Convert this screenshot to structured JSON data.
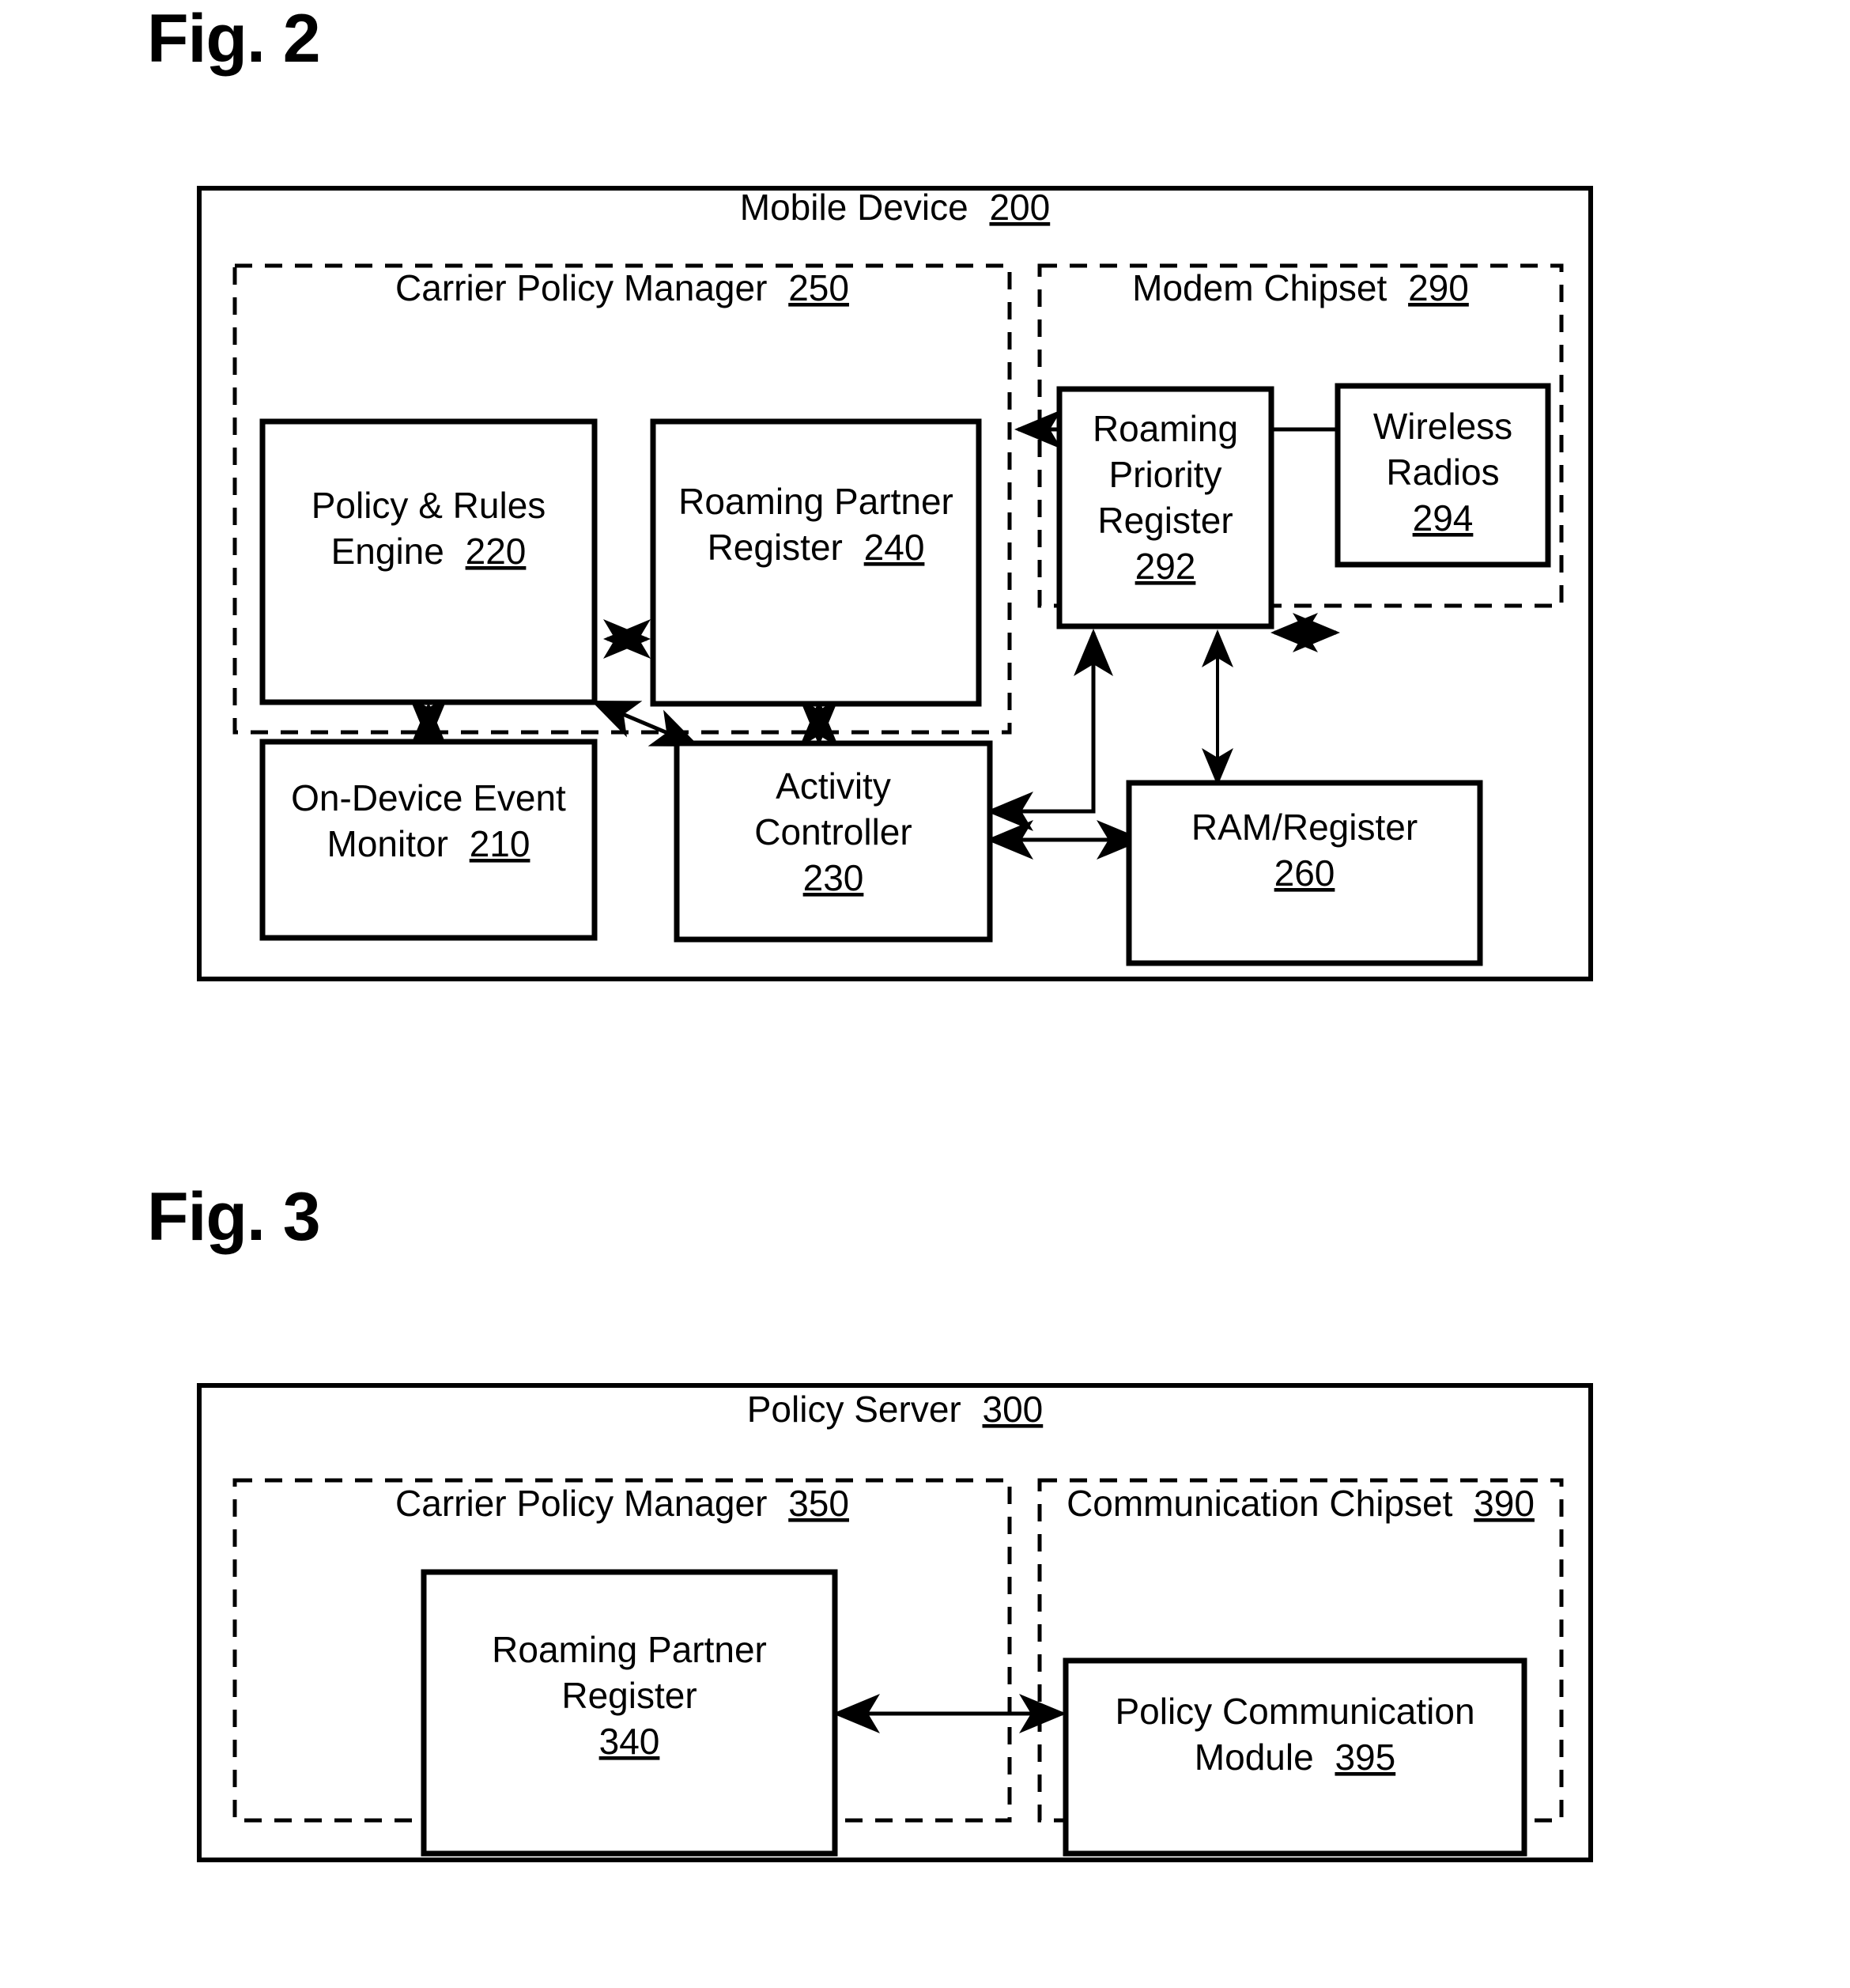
{
  "figures": [
    {
      "id": "fig2",
      "label": "Fig. 2",
      "outer": {
        "title_text": "Mobile Device",
        "title_ref": "200"
      },
      "sections": [
        {
          "name": "carrier-policy-manager",
          "title_text": "Carrier Policy Manager",
          "title_ref": "250"
        },
        {
          "name": "modem-chipset",
          "title_text": "Modem Chipset",
          "title_ref": "290"
        }
      ],
      "blocks": [
        {
          "name": "policy-rules-engine",
          "lines": [
            "Policy & Rules",
            "Engine"
          ],
          "ref": "220",
          "ref_on_line": 1
        },
        {
          "name": "roaming-partner-register",
          "lines": [
            "Roaming Partner",
            "Register"
          ],
          "ref": "240",
          "ref_on_line": 1
        },
        {
          "name": "on-device-event-monitor",
          "lines": [
            "On-Device Event",
            "Monitor"
          ],
          "ref": "210",
          "ref_on_line": 1
        },
        {
          "name": "activity-controller",
          "lines": [
            "Activity",
            "Controller"
          ],
          "ref": "230",
          "ref_on_line": 2
        },
        {
          "name": "roaming-priority-register",
          "lines": [
            "Roaming",
            "Priority",
            "Register"
          ],
          "ref": "292",
          "ref_on_line": 3
        },
        {
          "name": "wireless-radios",
          "lines": [
            "Wireless",
            "Radios"
          ],
          "ref": "294",
          "ref_on_line": 2
        },
        {
          "name": "ram-register",
          "lines": [
            "RAM/Register"
          ],
          "ref": "260",
          "ref_on_line": 1
        }
      ]
    },
    {
      "id": "fig3",
      "label": "Fig. 3",
      "outer": {
        "title_text": "Policy Server",
        "title_ref": "300"
      },
      "sections": [
        {
          "name": "carrier-policy-manager",
          "title_text": "Carrier Policy Manager",
          "title_ref": "350"
        },
        {
          "name": "communication-chipset",
          "title_text": "Communication Chipset",
          "title_ref": "390"
        }
      ],
      "blocks": [
        {
          "name": "roaming-partner-register",
          "lines": [
            "Roaming Partner",
            "Register"
          ],
          "ref": "340",
          "ref_on_line": 3
        },
        {
          "name": "policy-communication-module",
          "lines": [
            "Policy Communication",
            "Module"
          ],
          "ref": "395",
          "ref_on_line": 1
        }
      ]
    }
  ],
  "fig2": {
    "title_text": "Mobile Device",
    "title_ref": "200",
    "cpm_title": "Carrier Policy Manager",
    "cpm_ref": "250",
    "modem_title": "Modem Chipset",
    "modem_ref": "290",
    "pre_l1": "Policy & Rules",
    "pre_l2": "Engine",
    "pre_ref": "220",
    "rpr_l1": "Roaming Partner",
    "rpr_l2": "Register",
    "rpr_ref": "240",
    "odem_l1": "On-Device Event",
    "odem_l2": "Monitor",
    "odem_ref": "210",
    "ac_l1": "Activity",
    "ac_l2": "Controller",
    "ac_ref": "230",
    "rprio_l1": "Roaming",
    "rprio_l2": "Priority",
    "rprio_l3": "Register",
    "rprio_ref": "292",
    "wr_l1": "Wireless",
    "wr_l2": "Radios",
    "wr_ref": "294",
    "ram_l1": "RAM/Register",
    "ram_ref": "260"
  },
  "fig3": {
    "title_text": "Policy Server",
    "title_ref": "300",
    "cpm_title": "Carrier Policy Manager",
    "cpm_ref": "350",
    "cc_title": "Communication Chipset",
    "cc_ref": "390",
    "rpr_l1": "Roaming Partner",
    "rpr_l2": "Register",
    "rpr_ref": "340",
    "pcm_l1": "Policy Communication",
    "pcm_l2": "Module",
    "pcm_ref": "395"
  },
  "labels": {
    "fig2": "Fig. 2",
    "fig3": "Fig. 3"
  },
  "colors": {
    "ink": "#000000",
    "paper": "#ffffff"
  }
}
